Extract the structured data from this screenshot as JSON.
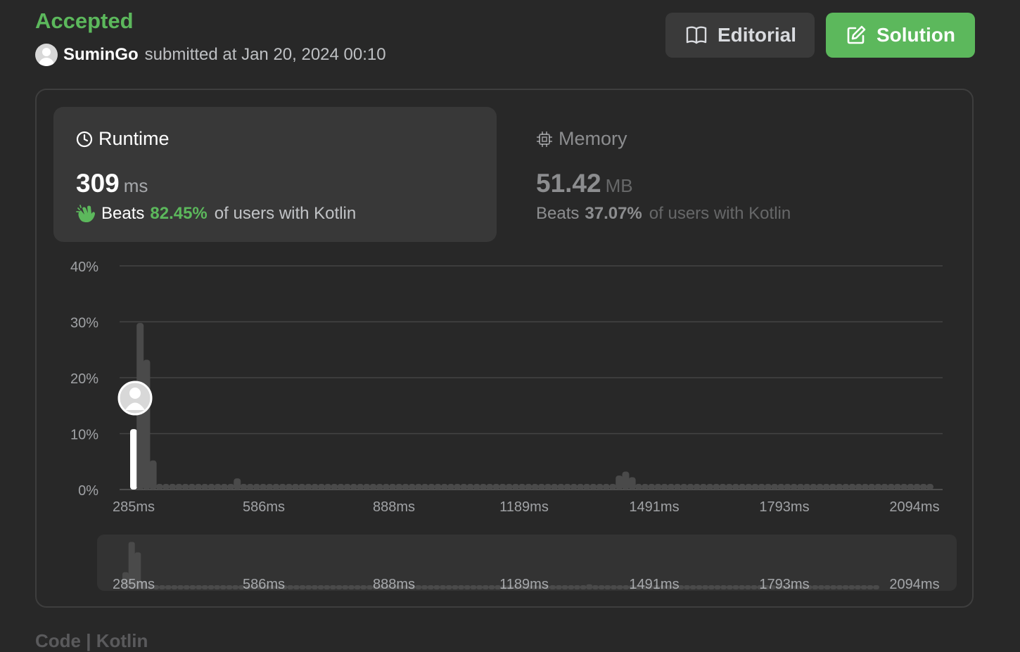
{
  "header": {
    "status": "Accepted",
    "username": "SuminGo",
    "submitted_text": "submitted at Jan 20, 2024 00:10",
    "editorial_label": "Editorial",
    "solution_label": "Solution"
  },
  "runtime": {
    "title": "Runtime",
    "value": "309",
    "unit": "ms",
    "beats_label": "Beats",
    "beats_pct": "82.45%",
    "beats_suffix": "of users with Kotlin"
  },
  "memory": {
    "title": "Memory",
    "value": "51.42",
    "unit": "MB",
    "beats_label": "Beats",
    "beats_pct": "37.07%",
    "beats_suffix": "of users with Kotlin"
  },
  "footer_tabs": "Code  |  Kotlin",
  "colors": {
    "accent": "#5cb85c",
    "bar": "#4a4a4a",
    "highlight": "#ffffff"
  },
  "chart_data": {
    "type": "bar",
    "ylim": [
      0,
      40
    ],
    "yticks": [
      "40%",
      "30%",
      "20%",
      "10%",
      "0%"
    ],
    "xticks": [
      "285ms",
      "586ms",
      "888ms",
      "1189ms",
      "1491ms",
      "1793ms",
      "2094ms"
    ],
    "highlight_index": 0,
    "values": [
      10.8,
      29.8,
      23.2,
      5.2,
      1.0,
      1.0,
      1.0,
      1.0,
      1.0,
      1.0,
      1.0,
      1.0,
      1.0,
      1.0,
      1.0,
      1.0,
      2.0,
      1.0,
      1.0,
      1.0,
      1.0,
      1.0,
      1.0,
      1.0,
      1.0,
      1.0,
      1.0,
      1.0,
      1.0,
      1.0,
      1.0,
      1.0,
      1.0,
      1.0,
      1.0,
      1.0,
      1.0,
      1.0,
      1.0,
      1.0,
      1.0,
      1.0,
      1.0,
      1.0,
      1.0,
      1.0,
      1.0,
      1.0,
      1.0,
      1.0,
      1.0,
      1.0,
      1.0,
      1.0,
      1.0,
      1.0,
      1.0,
      1.0,
      1.0,
      1.0,
      1.0,
      1.0,
      1.0,
      1.0,
      1.0,
      1.0,
      1.0,
      1.0,
      1.0,
      1.0,
      1.0,
      1.0,
      1.0,
      1.0,
      1.0,
      2.5,
      3.2,
      2.2,
      1.0,
      1.0,
      1.0,
      1.0,
      1.0,
      1.0,
      1.0,
      1.0,
      1.0,
      1.0,
      1.0,
      1.0,
      1.0,
      1.0,
      1.0,
      1.0,
      1.0,
      1.0,
      1.0,
      1.0,
      1.0,
      1.0,
      1.0,
      1.0,
      1.0,
      1.0,
      1.0,
      1.0,
      1.0,
      1.0,
      1.0,
      1.0,
      1.0,
      1.0,
      1.0,
      1.0,
      1.0,
      1.0,
      1.0,
      1.0,
      1.0,
      1.0,
      1.0,
      1.0,
      1.0,
      1.0
    ]
  }
}
